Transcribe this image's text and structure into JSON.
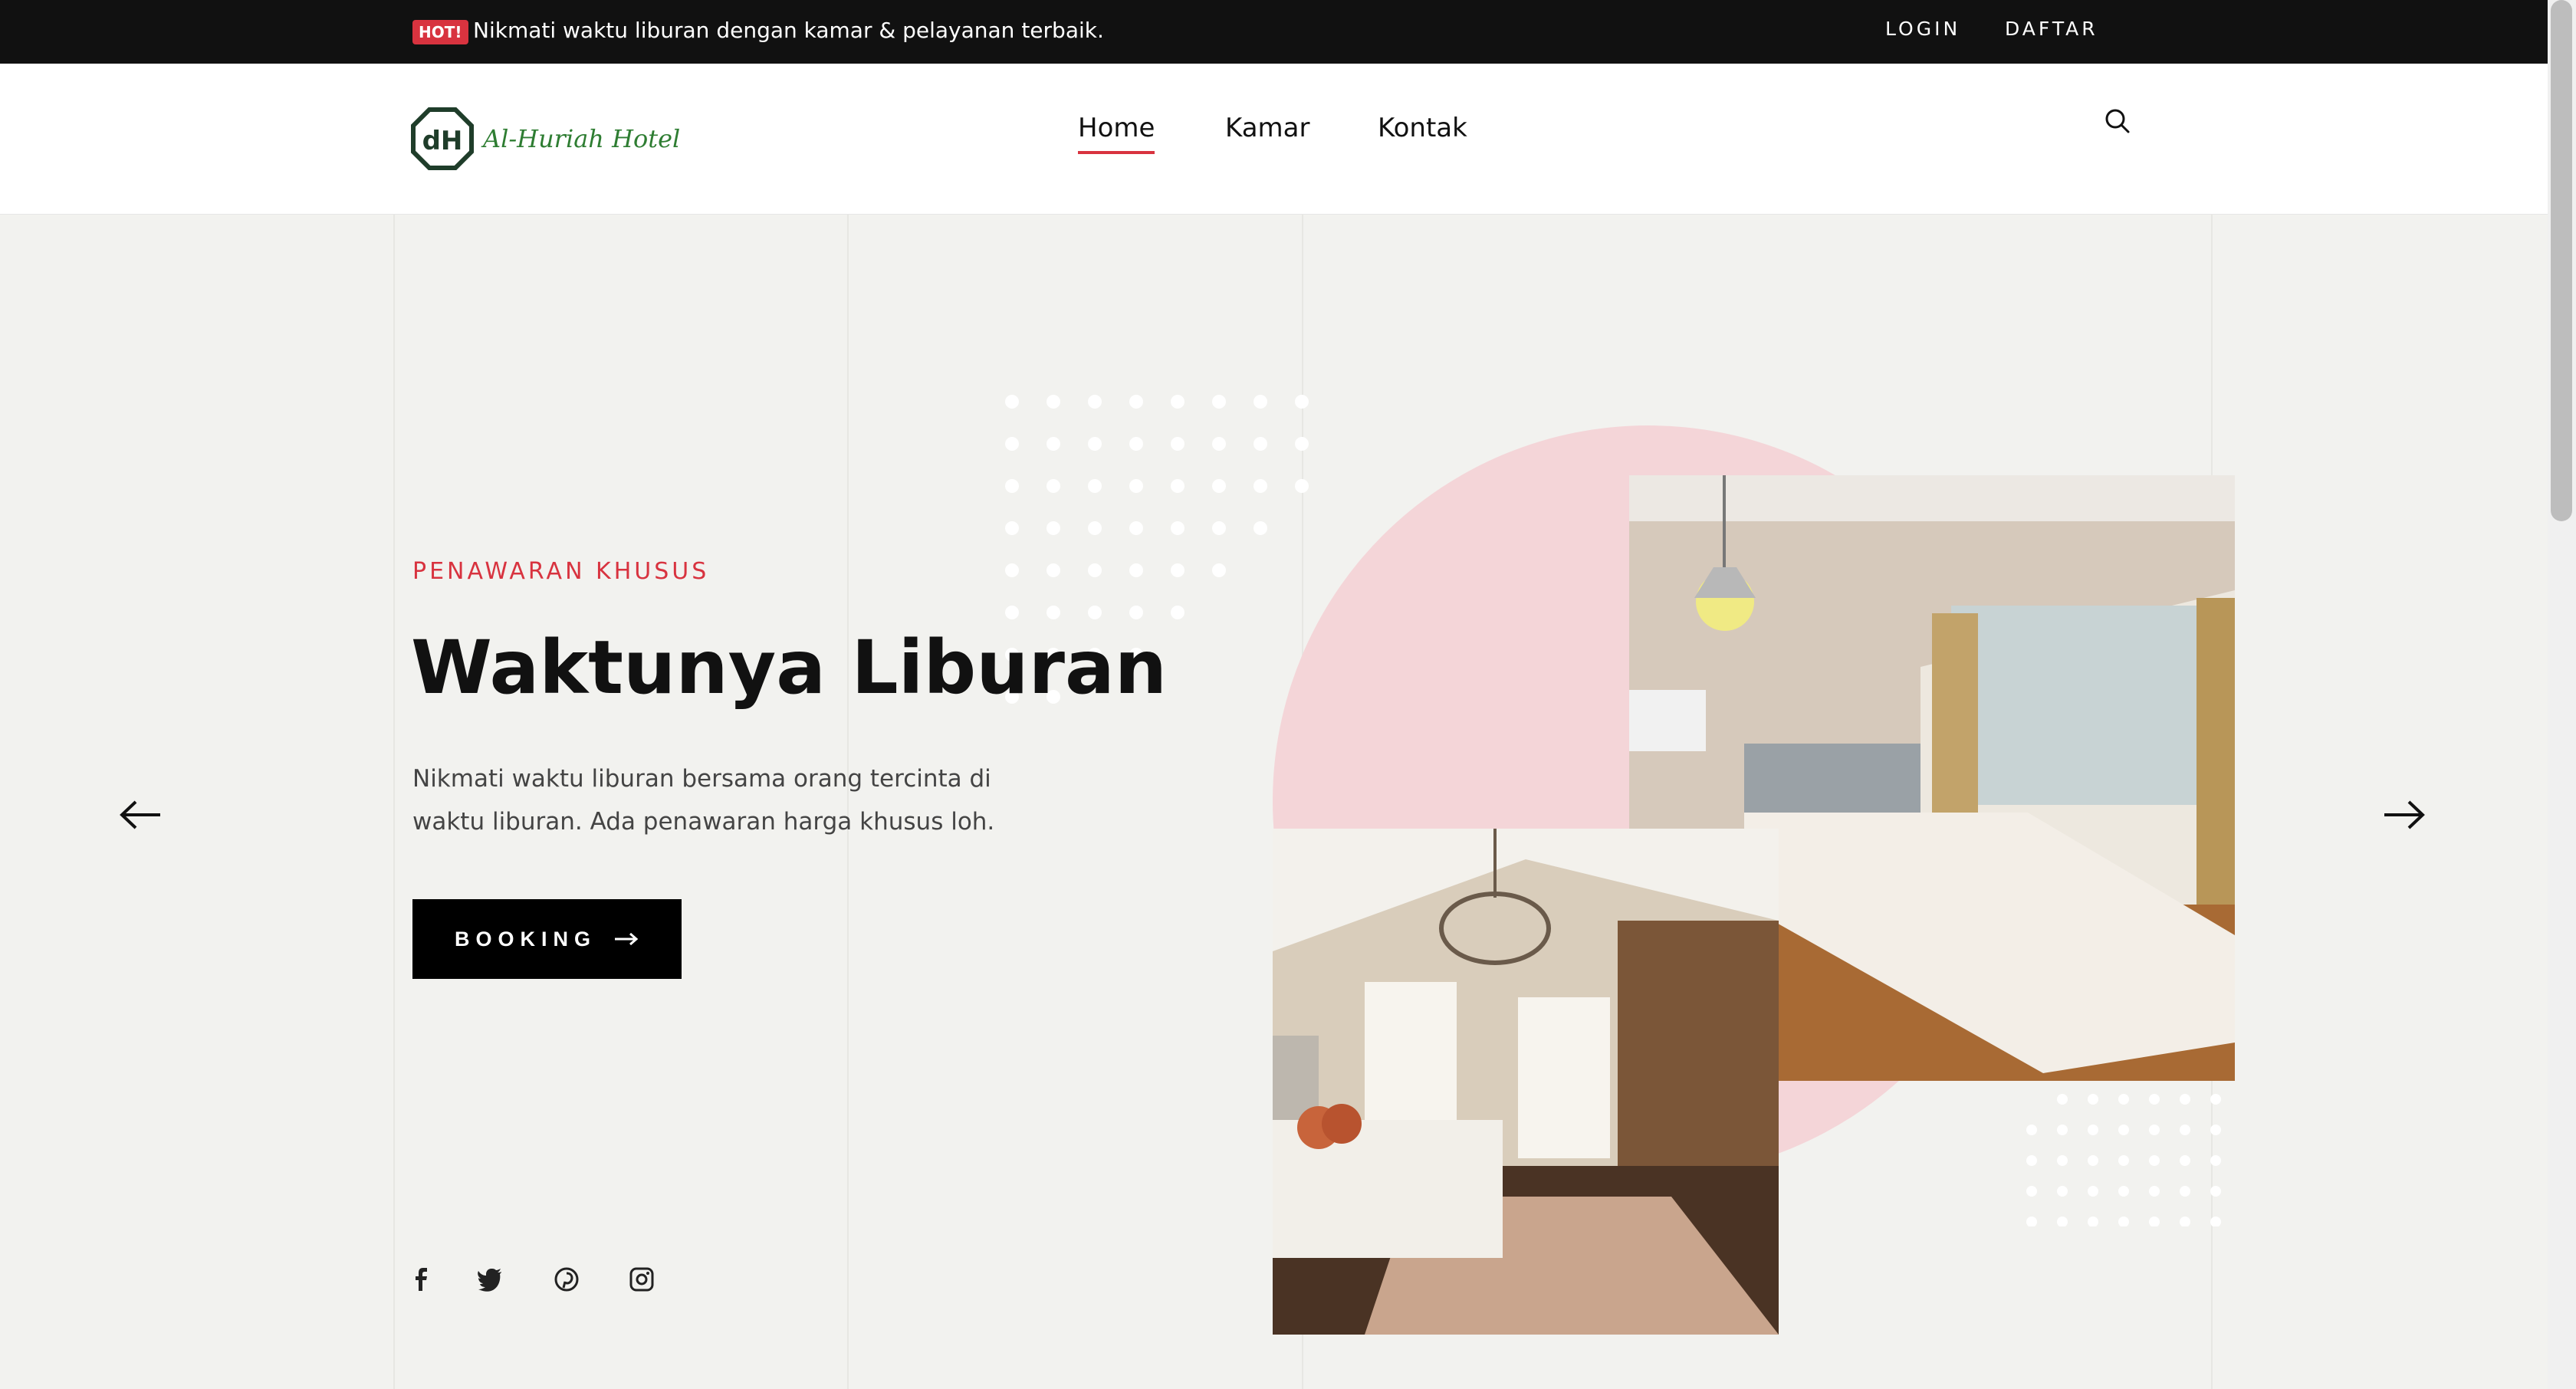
{
  "topbar": {
    "badge": "HOT!",
    "message": "Nikmati waktu liburan dengan kamar & pelayanan terbaik.",
    "login": "LOGIN",
    "register": "DAFTAR"
  },
  "header": {
    "logo_text": "Al-Huriah Hotel",
    "nav": [
      {
        "label": "Home",
        "active": true
      },
      {
        "label": "Kamar",
        "active": false
      },
      {
        "label": "Kontak",
        "active": false
      }
    ],
    "search_icon": "search-icon"
  },
  "hero": {
    "subtitle": "PENAWARAN KHUSUS",
    "title": "Waktunya Liburan",
    "description": "Nikmati waktu liburan bersama orang tercinta di waktu liburan. Ada penawaran harga khusus loh.",
    "booking_label": "BOOKING",
    "prev_icon": "arrow-left-icon",
    "next_icon": "arrow-right-icon"
  },
  "social": [
    "facebook-icon",
    "twitter-icon",
    "pinterest-icon",
    "instagram-icon"
  ],
  "colors": {
    "accent": "#d8333f",
    "topbar": "#111111",
    "hero_bg": "#f2f2ef",
    "circle": "#f4d5d8",
    "logo_green": "#2e7d32"
  }
}
